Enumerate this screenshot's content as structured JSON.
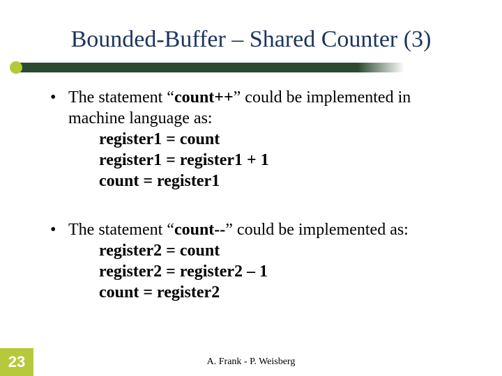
{
  "title": "Bounded-Buffer – Shared Counter (3)",
  "bullets": [
    {
      "intro_pre": "The statement “",
      "intro_bold": "count++",
      "intro_post": "” could be implemented in machine language as:",
      "code": [
        "register1 = count",
        "register1 = register1 + 1",
        "count = register1"
      ]
    },
    {
      "intro_pre": "The statement “",
      "intro_bold": "count--",
      "intro_post": "” could be implemented as:",
      "code": [
        "register2 = count",
        "register2 = register2 – 1",
        "count = register2"
      ]
    }
  ],
  "page": "23",
  "footer": "A. Frank - P. Weisberg"
}
